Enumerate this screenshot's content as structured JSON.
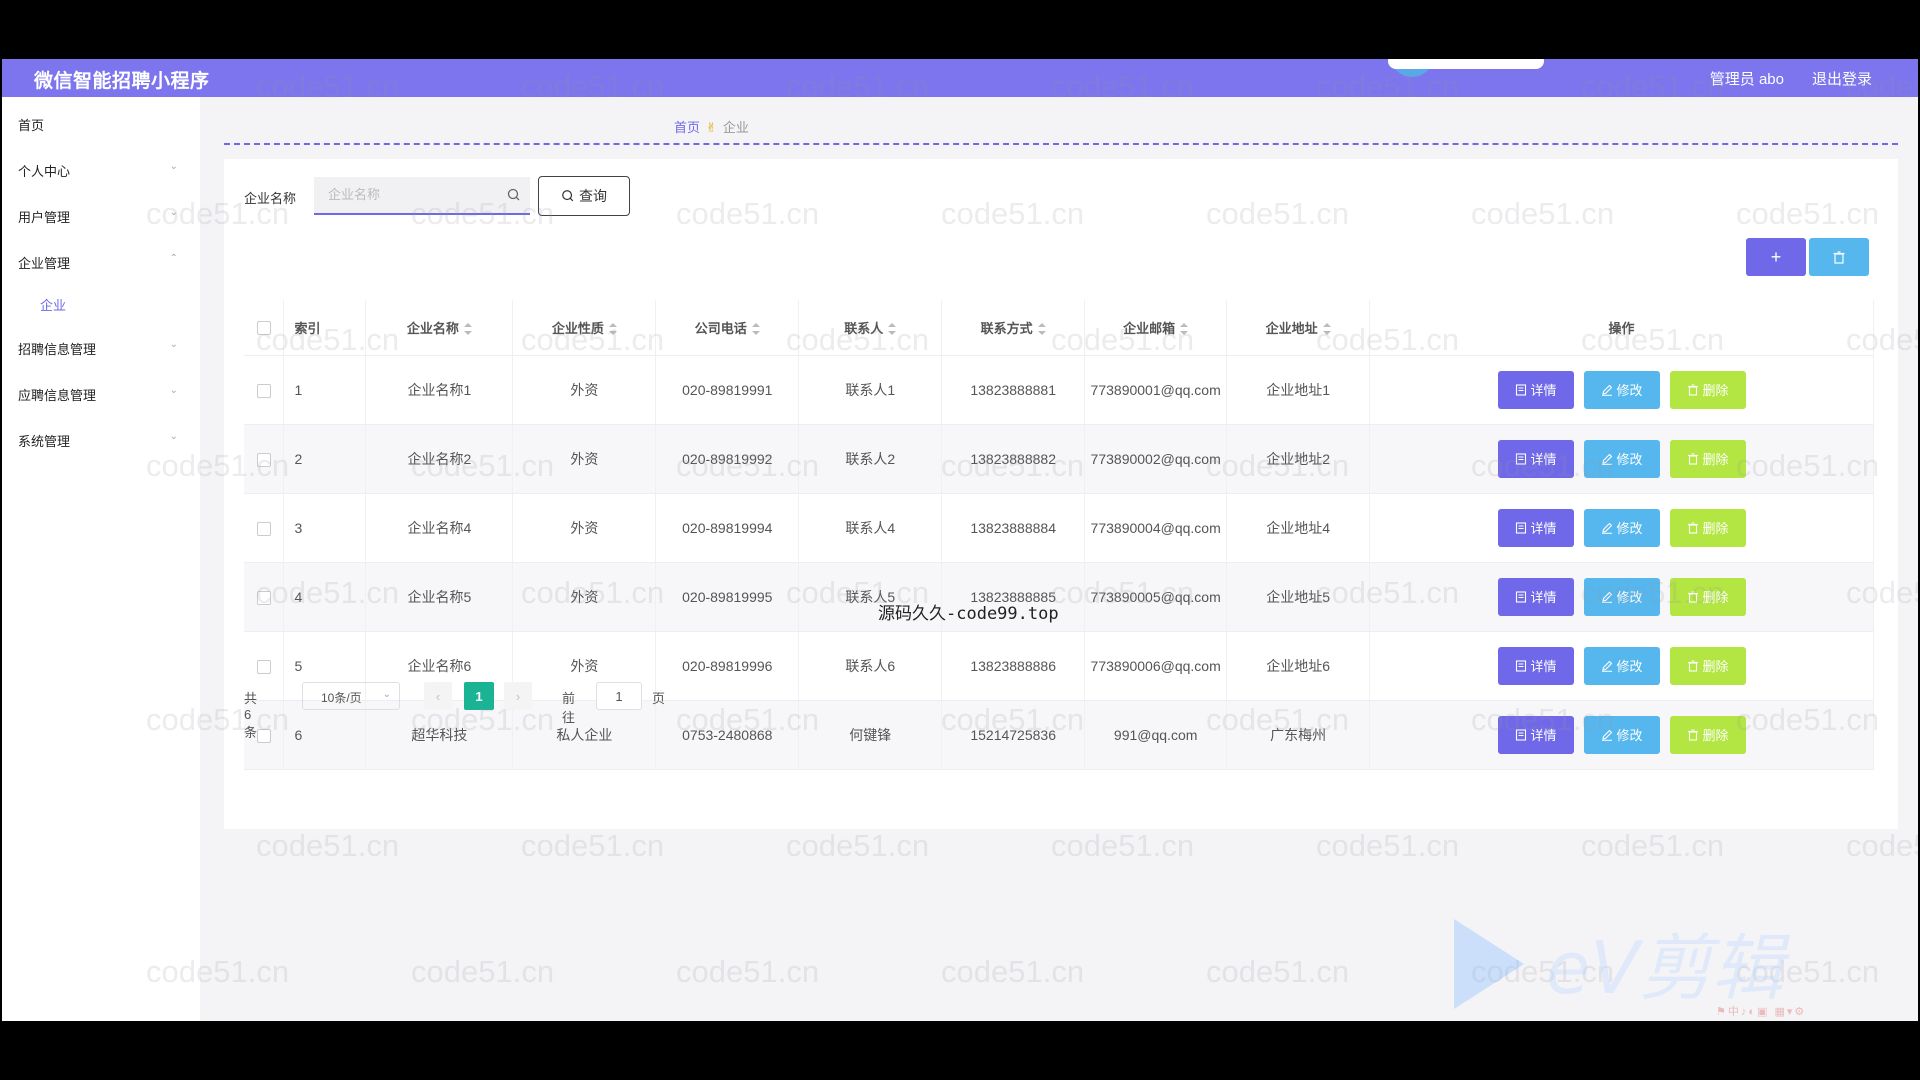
{
  "header": {
    "title": "微信智能招聘小程序",
    "admin": "管理员 abo",
    "logout": "退出登录"
  },
  "sidebar": {
    "items": [
      {
        "label": "首页"
      },
      {
        "label": "个人中心"
      },
      {
        "label": "用户管理"
      },
      {
        "label": "企业管理",
        "sub": "企业"
      },
      {
        "label": "招聘信息管理"
      },
      {
        "label": "应聘信息管理"
      },
      {
        "label": "系统管理"
      }
    ]
  },
  "breadcrumb": {
    "home": "首页",
    "current": "企业"
  },
  "search": {
    "label": "企业名称",
    "placeholder": "企业名称",
    "button": "查询"
  },
  "table": {
    "headers": [
      "索引",
      "企业名称",
      "企业性质",
      "公司电话",
      "联系人",
      "联系方式",
      "企业邮箱",
      "企业地址",
      "操作"
    ],
    "rows": [
      {
        "index": "1",
        "name": "企业名称1",
        "nature": "外资",
        "phone": "020-89819991",
        "contact": "联系人1",
        "mobile": "13823888881",
        "email": "773890001@qq.com",
        "address": "企业地址1"
      },
      {
        "index": "2",
        "name": "企业名称2",
        "nature": "外资",
        "phone": "020-89819992",
        "contact": "联系人2",
        "mobile": "13823888882",
        "email": "773890002@qq.com",
        "address": "企业地址2"
      },
      {
        "index": "3",
        "name": "企业名称4",
        "nature": "外资",
        "phone": "020-89819994",
        "contact": "联系人4",
        "mobile": "13823888884",
        "email": "773890004@qq.com",
        "address": "企业地址4"
      },
      {
        "index": "4",
        "name": "企业名称5",
        "nature": "外资",
        "phone": "020-89819995",
        "contact": "联系人5",
        "mobile": "13823888885",
        "email": "773890005@qq.com",
        "address": "企业地址5"
      },
      {
        "index": "5",
        "name": "企业名称6",
        "nature": "外资",
        "phone": "020-89819996",
        "contact": "联系人6",
        "mobile": "13823888886",
        "email": "773890006@qq.com",
        "address": "企业地址6"
      },
      {
        "index": "6",
        "name": "超华科技",
        "nature": "私人企业",
        "phone": "0753-2480868",
        "contact": "何键锋",
        "mobile": "15214725836",
        "email": "991@qq.com",
        "address": "广东梅州"
      }
    ],
    "actions": {
      "detail": "详情",
      "edit": "修改",
      "delete": "删除"
    }
  },
  "pagination": {
    "total": "共 6 条",
    "page_size": "10条/页",
    "current": "1",
    "goto": "前往",
    "goto_value": "1",
    "page_unit": "页"
  },
  "overlay": {
    "center_text": "源码久久-code99.top",
    "watermark": "code51.cn",
    "ev_logo": "eV剪辑"
  },
  "colors": {
    "primary": "#6f68e8",
    "edit": "#56b7ee",
    "delete": "#b3e642",
    "page_active": "#1ab394"
  },
  "icons": [
    "search-icon",
    "plus-icon",
    "trash-icon",
    "doc-icon",
    "pencil-icon",
    "chevron-down-icon",
    "chevron-left-icon",
    "chevron-right-icon"
  ]
}
